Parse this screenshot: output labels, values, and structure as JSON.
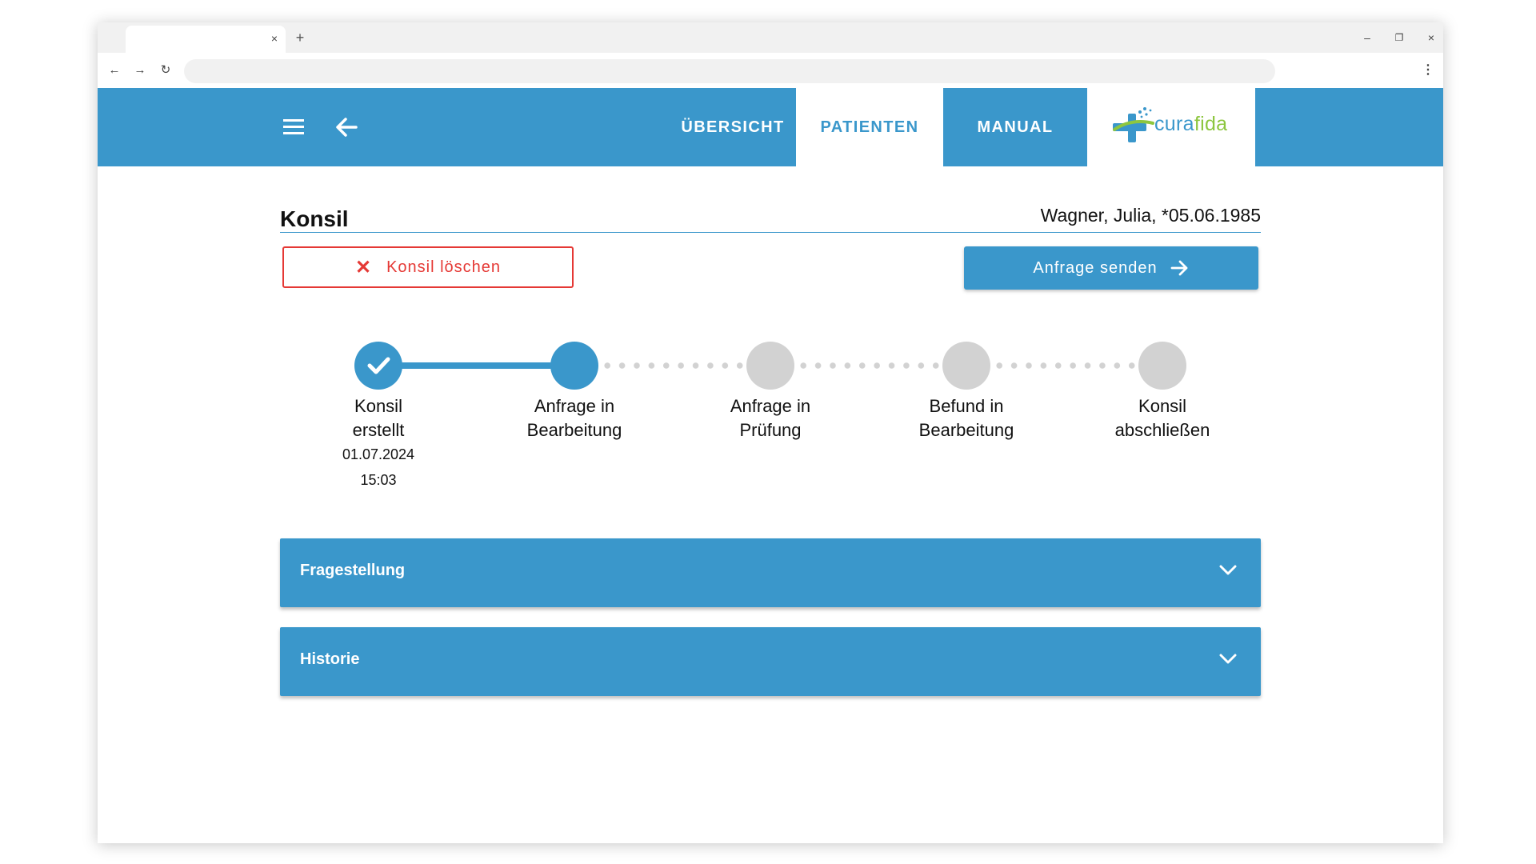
{
  "browser": {
    "tab_close_glyph": "×",
    "newtab_glyph": "+",
    "minimize_glyph": "–",
    "restore_glyph": "❐",
    "close_glyph": "×",
    "back_glyph": "←",
    "forward_glyph": "→",
    "reload_glyph": "↻",
    "menu_glyph": "⋮"
  },
  "header": {
    "nav": [
      {
        "label": "ÜBERSICHT",
        "active": false
      },
      {
        "label": "PATIENTEN",
        "active": true
      },
      {
        "label": "MANUAL",
        "active": false
      }
    ],
    "logo": {
      "part1": "cura",
      "part2": "fida"
    },
    "accent": "#3a97cb",
    "logo_green": "#8dc63f"
  },
  "page": {
    "title": "Konsil",
    "patient": "Wagner, Julia, *05.06.1985"
  },
  "actions": {
    "delete_label": "Konsil löschen",
    "delete_icon_glyph": "✕",
    "send_label": "Anfrage senden",
    "danger_color": "#e53935"
  },
  "stepper": {
    "steps": [
      {
        "line1": "Konsil",
        "line2": "erstellt",
        "status": "done",
        "date": "01.07.2024",
        "time": "15:03"
      },
      {
        "line1": "Anfrage in",
        "line2": "Bearbeitung",
        "status": "active"
      },
      {
        "line1": "Anfrage in",
        "line2": "Prüfung",
        "status": "pending"
      },
      {
        "line1": "Befund in",
        "line2": "Bearbeitung",
        "status": "pending"
      },
      {
        "line1": "Konsil",
        "line2": "abschließen",
        "status": "pending"
      }
    ]
  },
  "sections": [
    {
      "title": "Fragestellung"
    },
    {
      "title": "Historie"
    }
  ]
}
